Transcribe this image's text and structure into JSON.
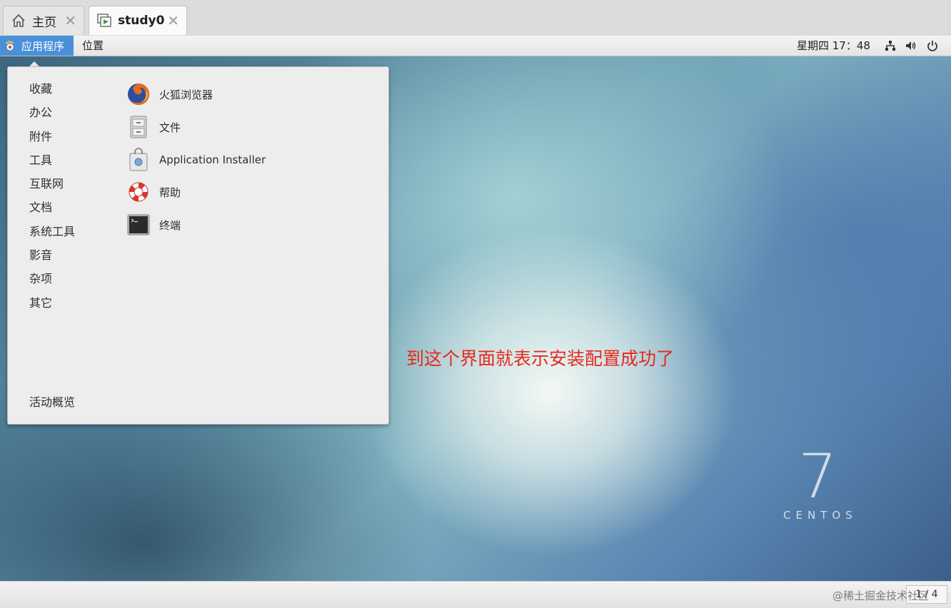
{
  "vm_tabs": [
    {
      "label": "主页",
      "icon": "home-icon"
    },
    {
      "label": "study0",
      "icon": "vm-running-icon"
    }
  ],
  "topbar": {
    "applications": "应用程序",
    "places": "位置",
    "clock": "星期四 17：48",
    "tray_icons": [
      "network-icon",
      "volume-icon",
      "power-icon"
    ]
  },
  "menu": {
    "categories": [
      "收藏",
      "办公",
      "附件",
      "工具",
      "互联网",
      "文档",
      "系统工具",
      "影音",
      "杂项",
      "其它"
    ],
    "apps": [
      {
        "label": "火狐浏览器",
        "icon": "firefox-icon"
      },
      {
        "label": "文件",
        "icon": "file-cabinet-icon"
      },
      {
        "label": "Application Installer",
        "icon": "installer-bag-icon"
      },
      {
        "label": "帮助",
        "icon": "lifebuoy-icon"
      },
      {
        "label": "终端",
        "icon": "terminal-icon"
      }
    ],
    "overview": "活动概览"
  },
  "annotation": "到这个界面就表示安装配置成功了",
  "branding": {
    "number": "7",
    "word": "CENTOS"
  },
  "bottombar": {
    "workspace": "1 / 4",
    "watermark": "@稀土掘金技术社区"
  },
  "colors": {
    "accent": "#4a90d9",
    "annotation": "#e8281c"
  }
}
